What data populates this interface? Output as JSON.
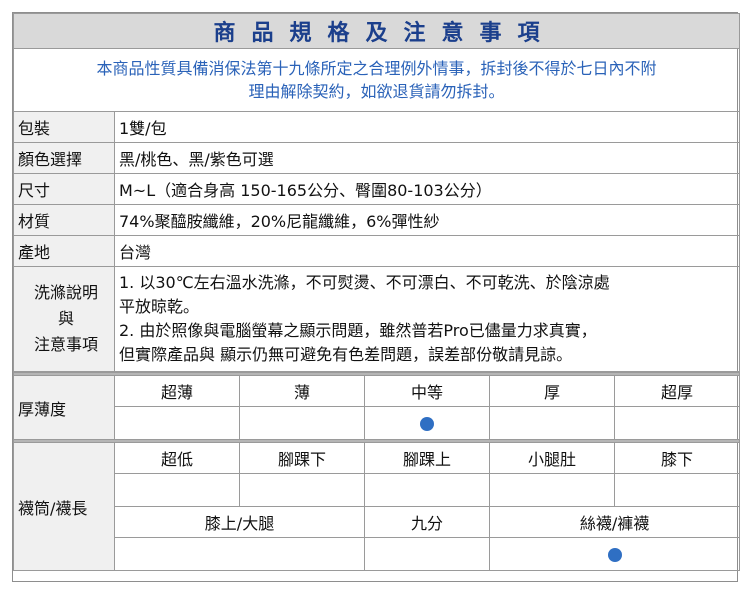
{
  "title": "商品規格及注意事項",
  "notice": {
    "line1": "本商品性質具備消保法第十九條所定之合理例外情事，拆封後不得於七日內不附",
    "line2": "理由解除契約，如欲退貨請勿拆封。"
  },
  "specs": {
    "package": {
      "label": "包裝",
      "value": "1雙/包"
    },
    "color": {
      "label": "顏色選擇",
      "value": "黑/桃色、黑/紫色可選"
    },
    "size": {
      "label": "尺寸",
      "value": "M~L（適合身高 150-165公分、臀圍80-103公分）"
    },
    "material": {
      "label": "材質",
      "value": "74%聚醯胺纖維，20%尼龍纖維，6%彈性紗"
    },
    "origin": {
      "label": "產地",
      "value": "台灣"
    }
  },
  "wash": {
    "label_line1": "洗滌說明",
    "label_line2": "與",
    "label_line3": "注意事項",
    "line1": "1. 以30℃左右溫水洗滌，不可熨燙、不可漂白、不可乾洗、於陰涼處",
    "line2": "平放晾乾。",
    "line3": "2. 由於照像與電腦螢幕之顯示問題，雖然普若Pro已儘量力求真實，",
    "line4": "但實際產品與 顯示仍無可避免有色差問題，誤差部份敬請見諒。"
  },
  "thickness": {
    "label": "厚薄度",
    "options": [
      "超薄",
      "薄",
      "中等",
      "厚",
      "超厚"
    ],
    "selected": "中等"
  },
  "length": {
    "label": "襪筒/襪長",
    "options_row1": [
      "超低",
      "腳踝下",
      "腳踝上",
      "小腿肚",
      "膝下"
    ],
    "options_row2": [
      "膝上/大腿",
      "九分",
      "絲襪/褲襪"
    ],
    "selected": "絲襪/褲襪"
  },
  "colors": {
    "title_text": "#1b3f8c",
    "notice_text": "#2a62b8",
    "marker": "#2f6fc3",
    "label_bg": "#f0f0f0"
  }
}
